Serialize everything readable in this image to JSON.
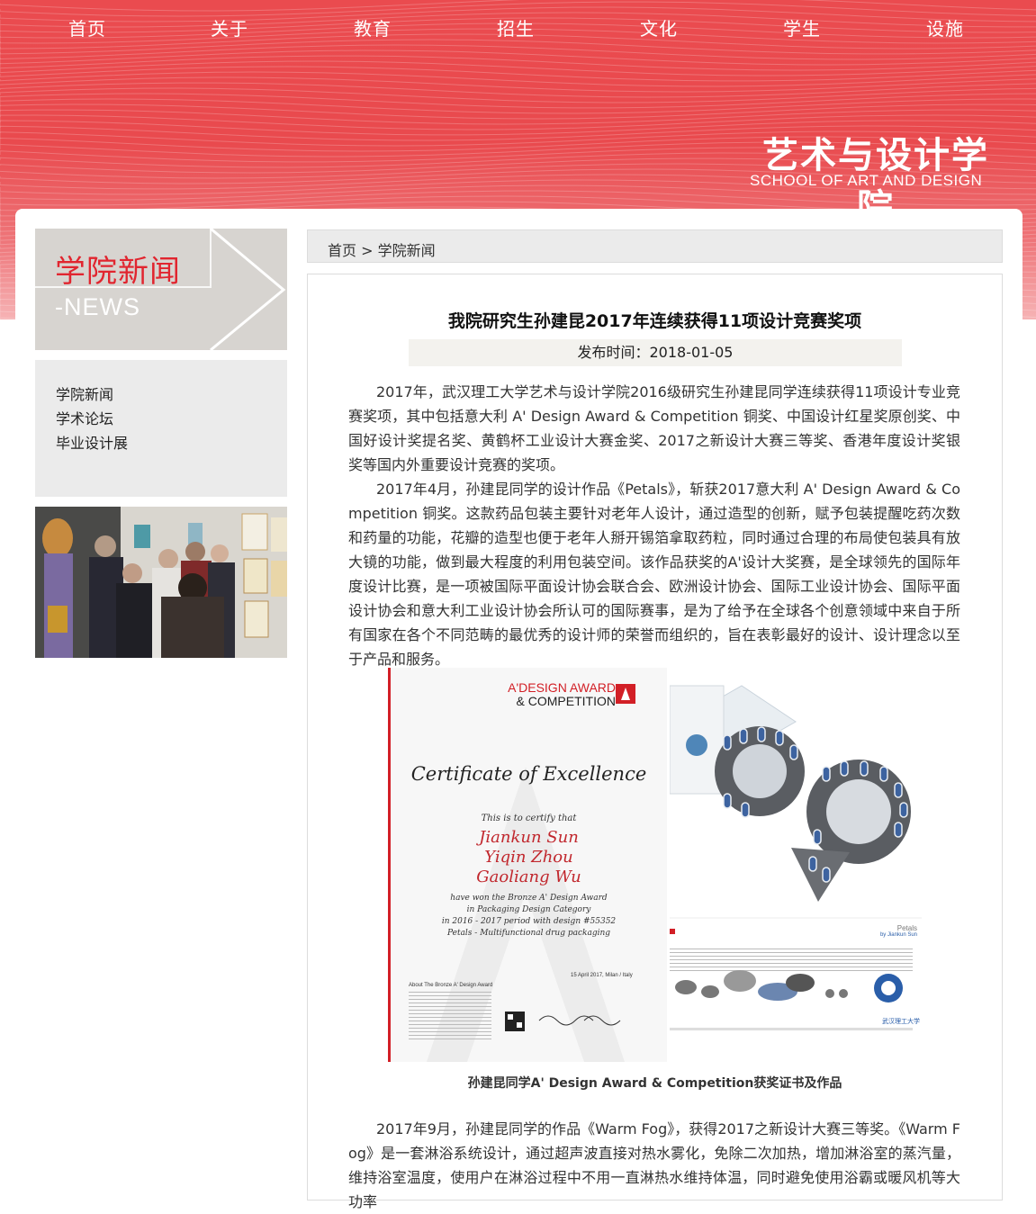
{
  "nav": {
    "items": [
      "首页",
      "关于",
      "教育",
      "招生",
      "文化",
      "学生",
      "设施"
    ]
  },
  "brand": {
    "name_cn": "艺术与设计学院",
    "name_en": "SCHOOL OF ART AND DESIGN"
  },
  "sidebar": {
    "title": "学院新闻",
    "subtitle": "-NEWS",
    "items": [
      {
        "label": "学院新闻"
      },
      {
        "label": "学术论坛"
      },
      {
        "label": "毕业设计展"
      }
    ]
  },
  "breadcrumb": {
    "home": "首页",
    "separator": ">",
    "current": "学院新闻"
  },
  "article": {
    "title": "我院研究生孙建昆2017年连续获得11项设计竞赛奖项",
    "date_label": "发布时间：2018-01-05",
    "paragraphs": [
      "2017年，武汉理工大学艺术与设计学院2016级研究生孙建昆同学连续获得11项设计专业竞赛奖项，其中包括意大利 A' Design Award & Competition 铜奖、中国设计红星奖原创奖、中国好设计奖提名奖、黄鹤杯工业设计大赛金奖、2017之新设计大赛三等奖、香港年度设计奖银奖等国内外重要设计竞赛的奖项。",
      "2017年4月，孙建昆同学的设计作品《Petals》，斩获2017意大利 A' Design Award & Competition 铜奖。这款药品包装主要针对老年人设计，通过造型的创新，赋予包装提醒吃药次数和药量的功能，花瓣的造型也便于老年人掰开锡箔拿取药粒，同时通过合理的布局使包装具有放大镜的功能，做到最大程度的利用包装空间。该作品获奖的A'设计大奖赛，是全球领先的国际年度设计比赛，是一项被国际平面设计协会联合会、欧洲设计协会、国际工业设计协会、国际平面设计协会和意大利工业设计协会所认可的国际赛事，是为了给予在全球各个创意领域中来自于所有国家在各个不同范畴的最优秀的设计师的荣誉而组织的，旨在表彰最好的设计、设计理念以至于产品和服务。",
      "2017年9月，孙建昆同学的作品《Warm Fog》，获得2017之新设计大赛三等奖。《Warm Fog》是一套淋浴系统设计，通过超声波直接对热水雾化，免除二次加热，增加淋浴室的蒸汽量，维持浴室温度，使用户在淋浴过程中不用一直淋热水维持体温，同时避免使用浴霸或暖风机等大功率"
    ],
    "figure_caption": "孙建昆同学A' Design Award & Competition获奖证书及作品",
    "certificate": {
      "header_line1": "A'DESIGN AWARD",
      "header_line2": "& COMPETITION",
      "heading": "Certificate of Excellence",
      "certify": "This is to certify that",
      "names": [
        "Jiankun Sun",
        "Yiqin Zhou",
        "Gaoliang Wu"
      ],
      "body_lines": [
        "have won the Bronze A' Design Award",
        "in Packaging Design Category",
        "in 2016 - 2017 period with design #55352",
        "Petals - Multifunctional drug packaging"
      ],
      "date_place": "15 April 2017, Milan / Italy",
      "about_title": "About The Bronze A' Design Award"
    },
    "product": {
      "title": "Petals",
      "byline": "by Jiankun Sun"
    }
  },
  "colors": {
    "banner_red": "#e94a4e",
    "accent_red": "#e1252f",
    "sidebar_gray": "#d7d4d0",
    "menu_gray": "#ebebeb"
  }
}
